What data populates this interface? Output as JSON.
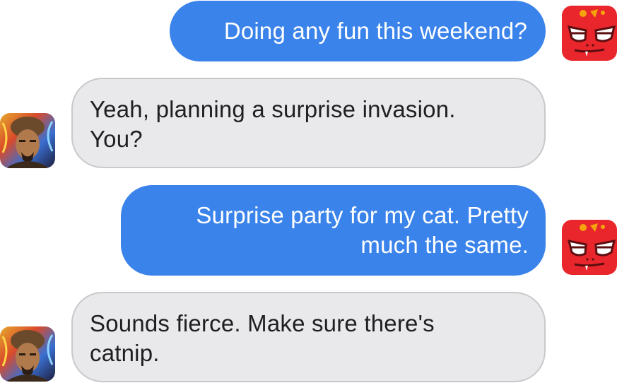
{
  "conversation": {
    "messages": [
      {
        "sender": "me",
        "avatar": "red-monster-avatar",
        "lines": [
          "Doing any fun this weekend?"
        ]
      },
      {
        "sender": "them",
        "avatar": "warrior-portrait-avatar",
        "lines": [
          "Yeah, planning a surprise invasion.",
          "You?"
        ]
      },
      {
        "sender": "me",
        "avatar": "red-monster-avatar",
        "lines": [
          "Surprise party for my cat. Pretty",
          "much the same."
        ]
      },
      {
        "sender": "them",
        "avatar": "warrior-portrait-avatar",
        "lines": [
          "Sounds fierce. Make sure there's",
          "catnip."
        ]
      }
    ]
  },
  "colors": {
    "outgoing_bubble": "#3a83ea",
    "incoming_bubble": "#e9e9eb",
    "monster_red": "#e8262b"
  }
}
